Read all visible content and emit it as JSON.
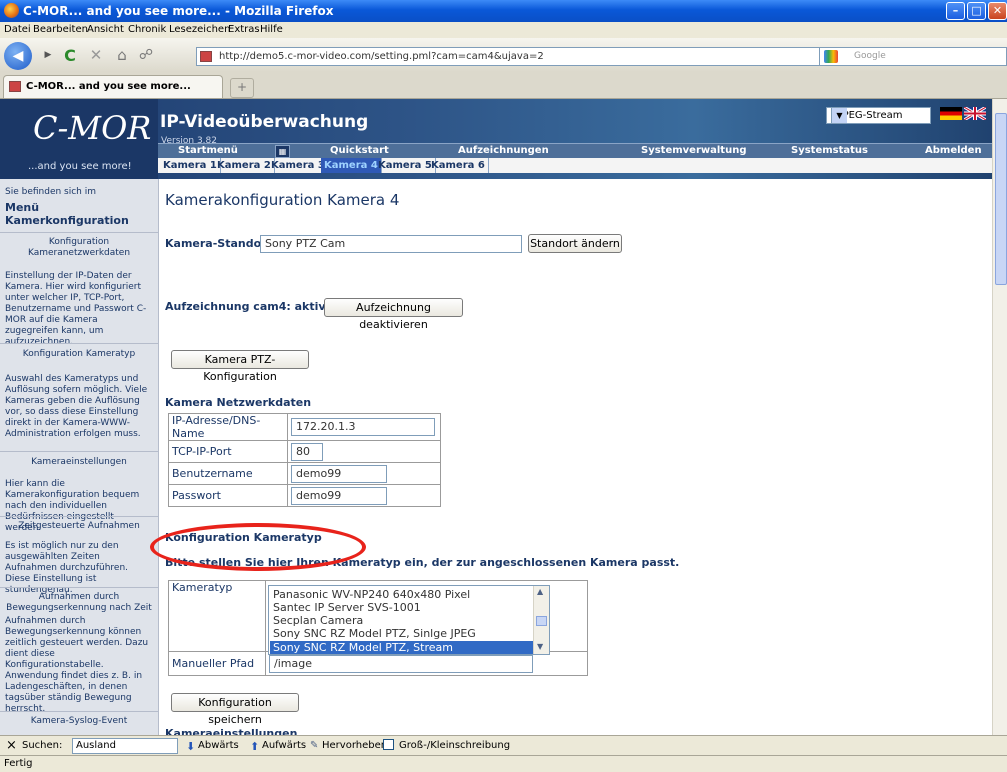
{
  "window": {
    "title": "C-MOR... and you see more... - Mozilla Firefox",
    "min": "–",
    "max": "□",
    "close": "✕"
  },
  "menubar": [
    "Datei",
    "Bearbeiten",
    "Ansicht",
    "Chronik",
    "Lesezeichen",
    "Extras",
    "Hilfe"
  ],
  "nav": {
    "url": "http://demo5.c-mor-video.com/setting.pml?cam=cam4&ujava=2",
    "search_placeholder": "Google"
  },
  "tab": {
    "label": "C-MOR... and you see more...",
    "new_tab": "+"
  },
  "header": {
    "logo": "C-MOR",
    "logo_tagline": "...and you see more!",
    "app_title": "IP-Videoüberwachung",
    "version": "Version 3.82",
    "stream_select": "MJPEG-Stream",
    "topnav": [
      "Startmenü",
      "Quickstart",
      "Aufzeichnungen",
      "Systemverwaltung",
      "Systemstatus",
      "Abmelden"
    ],
    "cameras": [
      "Kamera 1",
      "Kamera 2",
      "Kamera 3",
      "Kamera 4",
      "Kamera 5",
      "Kamera 6"
    ],
    "active_camera": "Kamera 4"
  },
  "sidebar": {
    "intro": "Sie befinden sich im",
    "menu_title": "Menü Kamerkonfiguration",
    "sections": [
      {
        "title": "Konfiguration Kameranetzwerkdaten",
        "text": "Einstellung der IP-Daten der Kamera. Hier wird konfiguriert unter welcher IP, TCP-Port, Benutzername und Passwort C-MOR auf die Kamera zugegreifen kann, um aufzuzeichnen."
      },
      {
        "title": "Konfiguration Kameratyp",
        "text": "Auswahl des Kameratyps und Auflösung sofern möglich. Viele Kameras geben die Auflösung vor, so dass diese Einstellung direkt in der Kamera-WWW-Administration erfolgen muss."
      },
      {
        "title": "Kameraeinstellungen",
        "text": "Hier kann die Kamerakonfiguration bequem nach den individuellen Bedürfnissen eingestellt werden."
      },
      {
        "title": "Zeitgesteuerte Aufnahmen",
        "text": "Es ist möglich nur zu den ausgewählten Zeiten Aufnahmen durchzuführen. Diese Einstellung ist stundengenau."
      },
      {
        "title": "Aufnahmen durch Bewegungserkennung nach Zeit",
        "text": "Aufnahmen durch Bewegungserkennung können zeitlich gesteuert werden. Dazu dient diese Konfigurationstabelle. Anwendung findet dies z. B. in Ladengeschäften, in denen tagsüber ständig Bewegung herrscht."
      },
      {
        "title": "Kamera-Syslog-Event",
        "text": ""
      }
    ]
  },
  "main": {
    "heading": "Kamerakonfiguration Kamera 4",
    "standort_label": "Kamera-Standort:",
    "standort_value": "Sony PTZ Cam",
    "standort_button": "Standort ändern",
    "aufzeichnung_label": "Aufzeichnung cam4: aktiviert",
    "aufzeichnung_button": "Aufzeichnung deaktivieren",
    "ptz_button": "Kamera PTZ-Konfiguration",
    "netzwerk_heading": "Kamera Netzwerkdaten",
    "netzwerk": [
      {
        "label": "IP-Adresse/DNS-Name",
        "value": "172.20.1.3"
      },
      {
        "label": "TCP-IP-Port",
        "value": "80"
      },
      {
        "label": "Benutzername",
        "value": "demo99"
      },
      {
        "label": "Passwort",
        "value": "demo99"
      }
    ],
    "kameratyp_heading": "Konfiguration Kameratyp",
    "kameratyp_hint": "Bitte stellen Sie hier Ihren Kameratyp ein, der zur angeschlossenen Kamera passt.",
    "kameratyp_label": "Kameratyp",
    "kameratyp_options": [
      "Panasonic WV-NP240 640x480 Pixel",
      "Santec IP Server SVS-1001",
      "Secplan Camera",
      "Sony SNC RZ Model PTZ, Sinlge JPEG",
      "Sony SNC RZ Model PTZ, Stream"
    ],
    "kameratyp_selected": "Sony SNC RZ Model PTZ, Stream",
    "pfad_label": "Manueller Pfad",
    "pfad_value": "/image",
    "save_button": "Konfiguration speichern",
    "next_heading": "Kameraeinstellungen"
  },
  "findbar": {
    "close": "×",
    "label": "Suchen:",
    "value": "Ausland",
    "down": "Abwärts",
    "up": "Aufwärts",
    "highlight": "Hervorheben",
    "case": "Groß-/Kleinschreibung"
  },
  "status": "Fertig"
}
